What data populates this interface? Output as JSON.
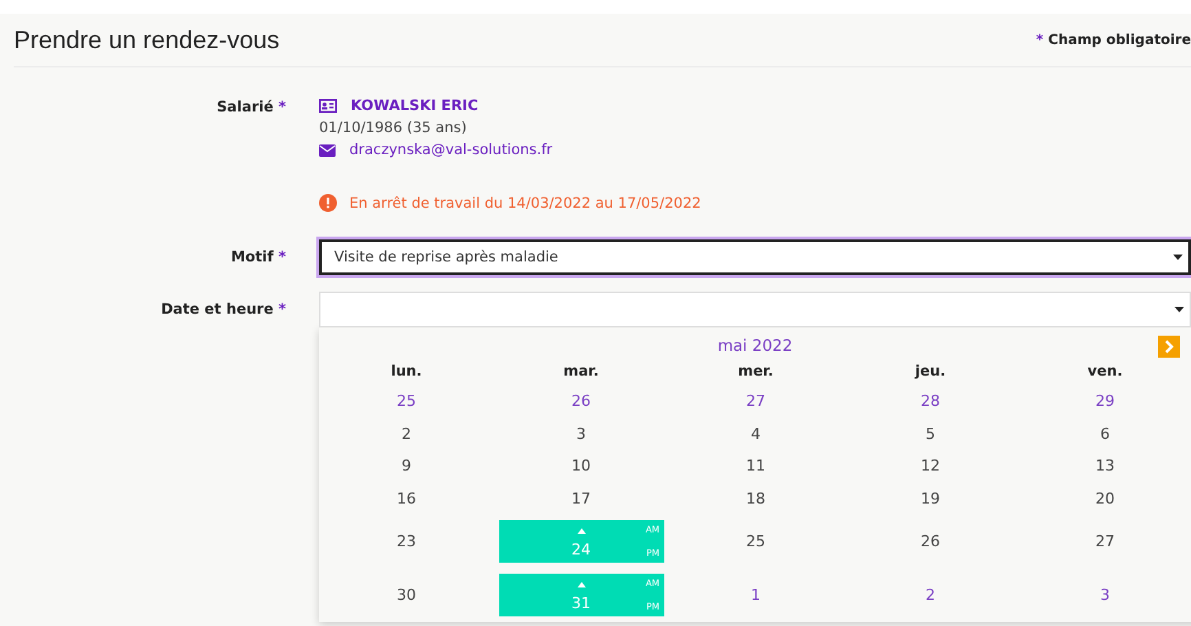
{
  "title": "Prendre un rendez-vous",
  "required_note": {
    "mark": "*",
    "text": "Champ obligatoire"
  },
  "employee": {
    "label": "Salarié",
    "mark": "*",
    "name": "KOWALSKI ERIC",
    "birth": "01/10/1986 (35 ans)",
    "email": "draczynska@val-solutions.fr",
    "alert": "En arrêt de travail du 14/03/2022 au 17/05/2022"
  },
  "motif": {
    "label": "Motif",
    "mark": "*",
    "value": "Visite de reprise après maladie",
    "focused": true
  },
  "datetime": {
    "label": "Date et heure",
    "mark": "*"
  },
  "calendar": {
    "month": "mai 2022",
    "weekdays": [
      "lun.",
      "mar.",
      "mer.",
      "jeu.",
      "ven."
    ],
    "weeks": [
      [
        {
          "day": "25",
          "kind": "other"
        },
        {
          "day": "26",
          "kind": "other"
        },
        {
          "day": "27",
          "kind": "other"
        },
        {
          "day": "28",
          "kind": "other"
        },
        {
          "day": "29",
          "kind": "other"
        }
      ],
      [
        {
          "day": "2",
          "kind": "day"
        },
        {
          "day": "3",
          "kind": "day"
        },
        {
          "day": "4",
          "kind": "day"
        },
        {
          "day": "5",
          "kind": "day"
        },
        {
          "day": "6",
          "kind": "day"
        }
      ],
      [
        {
          "day": "9",
          "kind": "day"
        },
        {
          "day": "10",
          "kind": "day"
        },
        {
          "day": "11",
          "kind": "day"
        },
        {
          "day": "12",
          "kind": "day"
        },
        {
          "day": "13",
          "kind": "day"
        }
      ],
      [
        {
          "day": "16",
          "kind": "day"
        },
        {
          "day": "17",
          "kind": "day"
        },
        {
          "day": "18",
          "kind": "day"
        },
        {
          "day": "19",
          "kind": "day"
        },
        {
          "day": "20",
          "kind": "day"
        }
      ],
      [
        {
          "day": "23",
          "kind": "day"
        },
        {
          "day": "24",
          "kind": "available",
          "am": "AM",
          "pm": "PM"
        },
        {
          "day": "25",
          "kind": "day"
        },
        {
          "day": "26",
          "kind": "day"
        },
        {
          "day": "27",
          "kind": "day"
        }
      ],
      [
        {
          "day": "30",
          "kind": "day"
        },
        {
          "day": "31",
          "kind": "available",
          "am": "AM",
          "pm": "PM"
        },
        {
          "day": "1",
          "kind": "other"
        },
        {
          "day": "2",
          "kind": "other"
        },
        {
          "day": "3",
          "kind": "other"
        }
      ]
    ]
  }
}
